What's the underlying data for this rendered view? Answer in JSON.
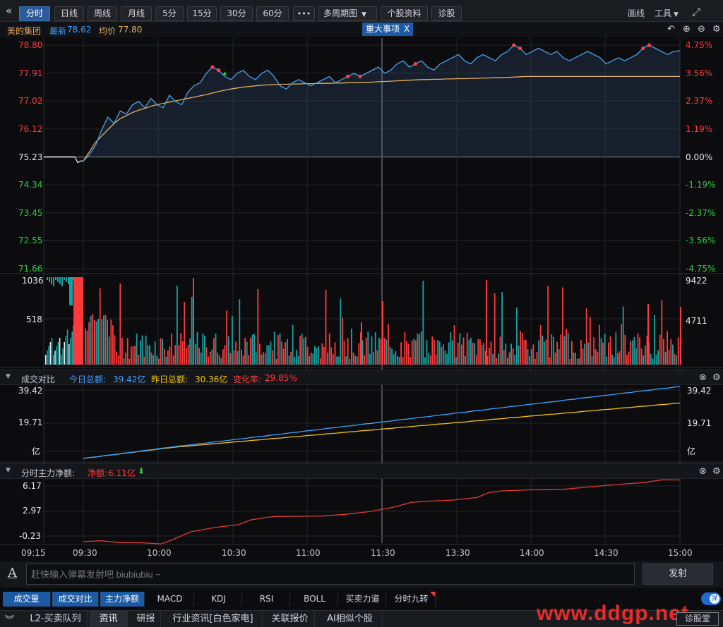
{
  "toolbar": {
    "collapse_icon": "double-chevron-left-icon",
    "periods": [
      "分时",
      "日线",
      "周线",
      "月线",
      "5分",
      "15分",
      "30分",
      "60分"
    ],
    "active_period": "分时",
    "more_label": "•••",
    "multi_period_label": "多周期图",
    "stock_info_label": "个股资料",
    "diagnose_label": "诊股",
    "draw_label": "画线",
    "tools_label": "工具",
    "expand_icon": "expand-icon"
  },
  "info": {
    "stock_name": "美的集团",
    "latest_label": "最新",
    "latest_value": "78.62",
    "avg_label": "均价",
    "avg_value": "77.80",
    "event_tag": "重大事项",
    "event_close": "X",
    "undo_icon": "undo-icon",
    "zoom_in_icon": "plus-circle-icon",
    "zoom_out_icon": "minus-circle-icon",
    "settings_icon": "gear-icon"
  },
  "colors": {
    "up": "#ff3a3a",
    "down": "#2ecc40",
    "price_line": "#4aa3f0",
    "avg_line": "#e0b060",
    "today_line": "#3ea0ff",
    "yesterday_line": "#f0c400",
    "net_line": "#e03a3a"
  },
  "chart_data": [
    {
      "type": "line",
      "title": "price",
      "price_ticks": [
        "78.80",
        "77.91",
        "77.02",
        "76.12",
        "75.23",
        "74.34",
        "73.45",
        "72.55",
        "71.66"
      ],
      "pct_ticks": [
        "4.75%",
        "3.56%",
        "2.37%",
        "1.19%",
        "0.00%",
        "-1.19%",
        "-2.37%",
        "-3.56%",
        "-4.75%"
      ],
      "ylim": [
        71.66,
        78.8
      ],
      "prev_close": 75.23,
      "pre_open_price": 75.23,
      "x_labels": [
        "09:15",
        "09:30",
        "10:00",
        "10:30",
        "11:00",
        "11:30",
        "13:30",
        "14:00",
        "14:30",
        "15:00"
      ],
      "series": [
        {
          "values": [
            75.1,
            75.3,
            75.6,
            76.1,
            76.5,
            76.3,
            76.7,
            76.6,
            76.9,
            77.0,
            76.8,
            77.1,
            76.9,
            76.8,
            77.2,
            77.0,
            76.9,
            77.3,
            77.5,
            77.6,
            77.9,
            78.1,
            78.0,
            77.8,
            77.7,
            77.9,
            78.0,
            77.8,
            77.7,
            77.9,
            78.0,
            77.8,
            77.5,
            77.4,
            77.6,
            77.7,
            77.6,
            77.5,
            77.6,
            77.7,
            77.8,
            77.6,
            77.7,
            77.8,
            77.9,
            77.8,
            77.9,
            78.0,
            78.1,
            77.9,
            78.0,
            78.2,
            78.3,
            78.1,
            78.2,
            78.3,
            78.1,
            78.0,
            78.2,
            78.3,
            78.4,
            78.5,
            78.3,
            78.2,
            78.4,
            78.5,
            78.4,
            78.3,
            78.5,
            78.6,
            78.8,
            78.7,
            78.5,
            78.6,
            78.7,
            78.6,
            78.5,
            78.6,
            78.4,
            78.3,
            78.4,
            78.5,
            78.6,
            78.5,
            78.4,
            78.2,
            78.3,
            78.4,
            78.3,
            78.4,
            78.5,
            78.7,
            78.8,
            78.7,
            78.6,
            78.5,
            78.6,
            78.62
          ]
        },
        {
          "values": [
            75.1,
            75.4,
            75.7,
            75.9,
            76.1,
            76.3,
            76.45,
            76.55,
            76.65,
            76.72,
            76.78,
            76.85,
            76.9,
            76.94,
            76.98,
            77.02,
            77.06,
            77.1,
            77.14,
            77.18,
            77.22,
            77.27,
            77.32,
            77.36,
            77.4,
            77.43,
            77.46,
            77.48,
            77.5,
            77.52,
            77.53,
            77.54,
            77.55,
            77.55,
            77.56,
            77.56,
            77.57,
            77.57,
            77.58,
            77.58,
            77.58,
            77.59,
            77.59,
            77.6,
            77.6,
            77.61,
            77.61,
            77.62,
            77.63,
            77.64,
            77.65,
            77.66,
            77.67,
            77.68,
            77.69,
            77.7,
            77.7,
            77.71,
            77.71,
            77.72,
            77.72,
            77.73,
            77.73,
            77.74,
            77.74,
            77.75,
            77.75,
            77.76,
            77.76,
            77.77,
            77.78,
            77.79,
            77.8,
            77.8,
            77.8,
            77.8,
            77.8,
            77.8,
            77.8,
            77.8,
            77.8,
            77.8,
            77.8,
            77.8,
            77.8,
            77.8,
            77.8,
            77.8,
            77.8,
            77.8,
            77.8,
            77.8,
            77.8,
            77.8,
            77.8,
            77.8,
            77.8,
            77.8
          ]
        }
      ],
      "series_labels": [
        "最新",
        "均价"
      ],
      "markers": [
        21,
        22,
        43,
        45,
        54,
        70,
        71,
        91,
        92
      ]
    },
    {
      "type": "bar",
      "title": "volume",
      "left_ticks": [
        "1036",
        "518"
      ],
      "right_ticks": [
        "9422",
        "4711"
      ],
      "ylim": [
        0,
        1036
      ]
    },
    {
      "type": "line",
      "title": "成交对比",
      "today_label": "今日总额:",
      "today_value": "39.42亿",
      "yesterday_label": "昨日总额:",
      "yesterday_value": "30.36亿",
      "change_label": "变化率:",
      "change_value": "29.85%",
      "ticks": [
        "39.42",
        "19.71",
        "亿"
      ],
      "ylim": [
        0,
        39.42
      ]
    },
    {
      "type": "line",
      "title": "分时主力净额:",
      "net_label": "净额:",
      "net_value": "6.11亿",
      "ticks": [
        "6.17",
        "2.97",
        "-0.23"
      ],
      "ylim": [
        -0.23,
        6.17
      ]
    }
  ],
  "input": {
    "font_icon": "text-style-icon",
    "placeholder": "赶快输入弹幕发射吧 biubiubiu ~",
    "send_label": "发射"
  },
  "indicator_tabs": [
    "成交量",
    "成交对比",
    "主力净额",
    "MACD",
    "KDJ",
    "RSI",
    "BOLL",
    "买卖力道",
    "分时九转"
  ],
  "danmu_toggle_label": "弹",
  "bottom": {
    "collapse_icon": "double-chevron-down-icon",
    "tabs": [
      "L2-买卖队列",
      "资讯",
      "研报",
      "行业资讯[白色家电]",
      "关联报价",
      "AI相似个股"
    ],
    "active_tab": "资讯",
    "watermark": "www.ddgp.net",
    "diagnose_hall": "诊股堂"
  }
}
